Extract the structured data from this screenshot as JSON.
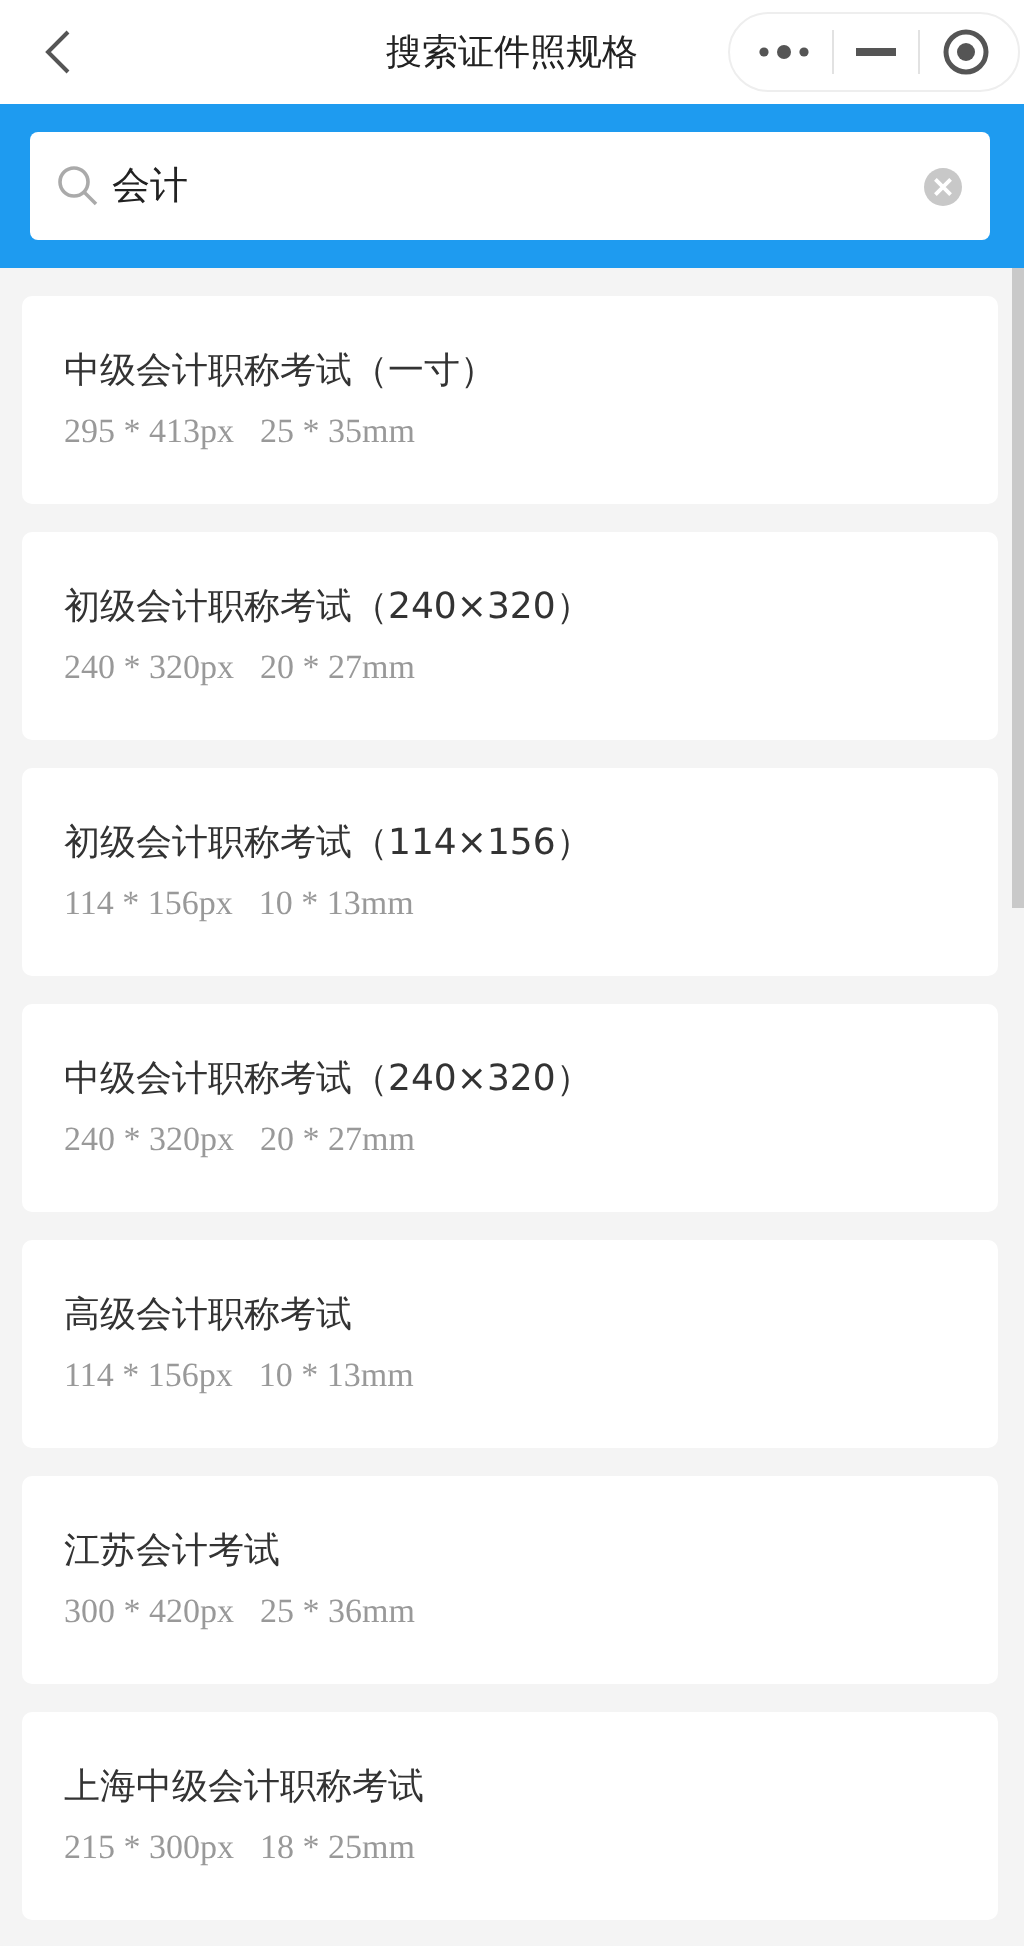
{
  "nav": {
    "title": "搜索证件照规格"
  },
  "search": {
    "value": "会计"
  },
  "results": [
    {
      "name": "中级会计职称考试（一寸）",
      "pixels": "295 * 413px",
      "millimeters": "25 * 35mm"
    },
    {
      "name": "初级会计职称考试（240×320）",
      "pixels": "240 * 320px",
      "millimeters": "20 * 27mm"
    },
    {
      "name": "初级会计职称考试（114×156）",
      "pixels": "114 * 156px",
      "millimeters": "10 * 13mm"
    },
    {
      "name": "中级会计职称考试（240×320）",
      "pixels": "240 * 320px",
      "millimeters": "20 * 27mm"
    },
    {
      "name": "高级会计职称考试",
      "pixels": "114 * 156px",
      "millimeters": "10 * 13mm"
    },
    {
      "name": "江苏会计考试",
      "pixels": "300 * 420px",
      "millimeters": "25 * 36mm"
    },
    {
      "name": "上海中级会计职称考试",
      "pixels": "215 * 300px",
      "millimeters": "18 * 25mm"
    }
  ]
}
